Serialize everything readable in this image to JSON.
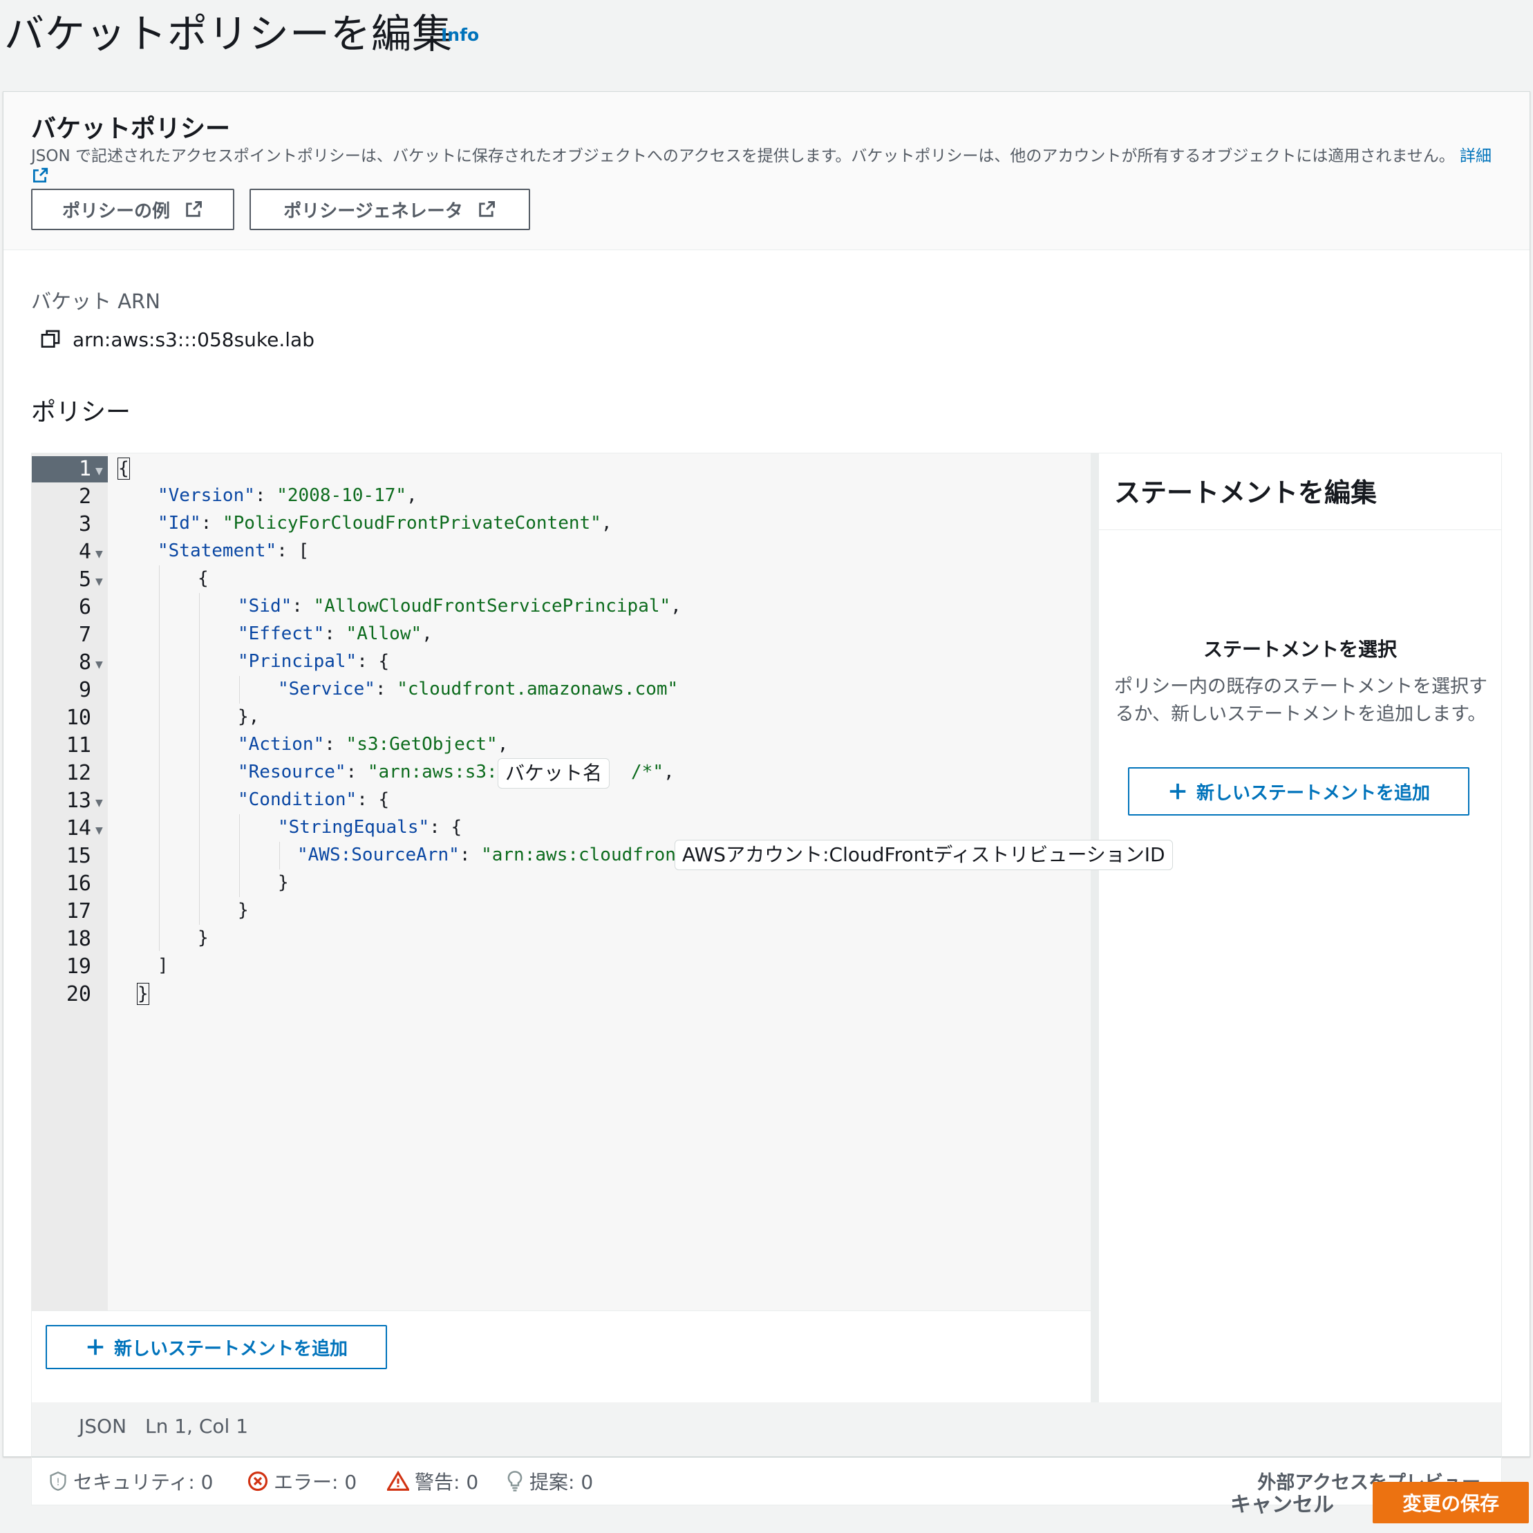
{
  "header": {
    "title": "バケットポリシーを編集",
    "info": "Info"
  },
  "policy_panel": {
    "title": "バケットポリシー",
    "description": "JSON で記述されたアクセスポイントポリシーは、バケットに保存されたオブジェクトへのアクセスを提供します。バケットポリシーは、他のアカウントが所有するオブジェクトには適用されません。",
    "details_link": "詳細",
    "policy_examples_button": "ポリシーの例",
    "policy_generator_button": "ポリシージェネレータ"
  },
  "bucket_arn": {
    "label": "バケット ARN",
    "value": "arn:aws:s3:::058suke.lab"
  },
  "policy_label": "ポリシー",
  "editor": {
    "line_numbers": [
      "1",
      "2",
      "3",
      "4",
      "5",
      "6",
      "7",
      "8",
      "9",
      "10",
      "11",
      "12",
      "13",
      "14",
      "15",
      "16",
      "17",
      "18",
      "19",
      "20"
    ],
    "lines": {
      "l1": "{",
      "l2_key": "\"Version\"",
      "l2_val": "\"2008-10-17\"",
      "l3_key": "\"Id\"",
      "l3_val": "\"PolicyForCloudFrontPrivateContent\"",
      "l4_key": "\"Statement\"",
      "l4_rest": ": [",
      "l5": "{",
      "l6_key": "\"Sid\"",
      "l6_val": "\"AllowCloudFrontServicePrincipal\"",
      "l7_key": "\"Effect\"",
      "l7_val": "\"Allow\"",
      "l8_key": "\"Principal\"",
      "l8_rest": ": {",
      "l9_key": "\"Service\"",
      "l9_val": "\"cloudfront.amazonaws.com\"",
      "l10": "},",
      "l11_key": "\"Action\"",
      "l11_val": "\"s3:GetObject\"",
      "l12_key": "\"Resource\"",
      "l12_val_a": "\"arn:aws:s3:::",
      "l12_val_b": "/*\"",
      "l13_key": "\"Condition\"",
      "l13_rest": ": {",
      "l14_key": "\"StringEquals\"",
      "l14_rest": ": {",
      "l15_key": "\"AWS:SourceArn\"",
      "l15_val_a": "\"arn:aws:cloudfront::",
      "l16": "}",
      "l17": "}",
      "l18": "}",
      "l19": "]",
      "l20": "}"
    },
    "placeholder_bucket_name": "バケット名",
    "placeholder_distribution": "AWSアカウント:CloudFrontディストリビューションID",
    "add_statement_button": "新しいステートメントを追加"
  },
  "side_panel": {
    "title": "ステートメントを編集",
    "subtitle": "ステートメントを選択",
    "description": "ポリシー内の既存のステートメントを選択するか、新しいステートメントを追加します。",
    "add_statement_button": "新しいステートメントを追加"
  },
  "status_bar": {
    "language": "JSON",
    "position": "Ln 1, Col 1"
  },
  "analysis": {
    "security": "セキュリティ: 0",
    "errors": "エラー: 0",
    "warnings": "警告: 0",
    "suggestions": "提案: 0",
    "preview_external_access": "外部アクセスをプレビュー"
  },
  "footer": {
    "cancel": "キャンセル",
    "save": "変更の保存"
  },
  "colors": {
    "accent_orange": "#ec7211",
    "link_blue": "#0073bb",
    "error_red": "#d13212"
  }
}
